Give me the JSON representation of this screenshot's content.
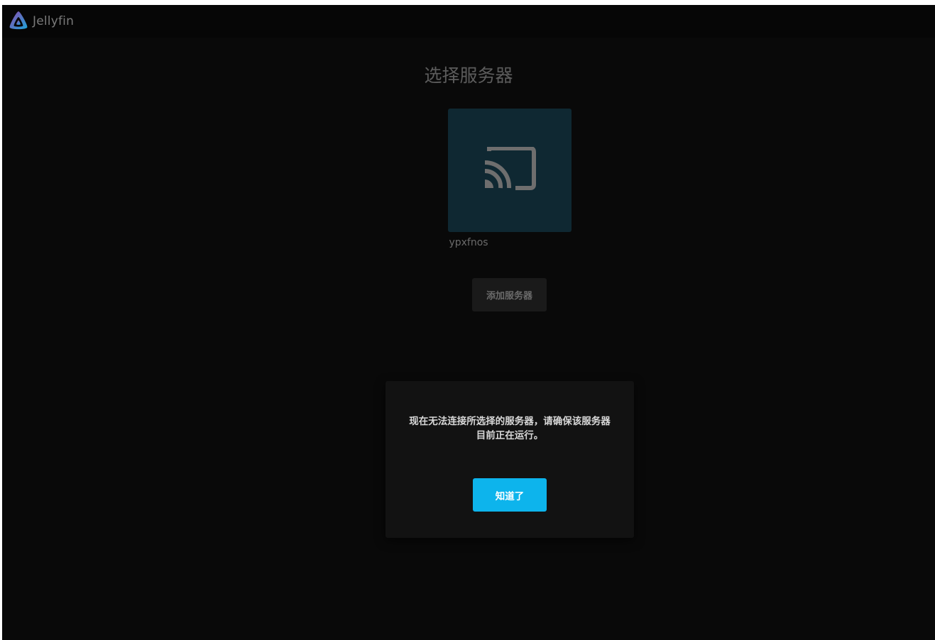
{
  "app": {
    "brand_name": "Jellyfin",
    "logo_icon": "jellyfin-logo-icon"
  },
  "page": {
    "title": "选择服务器"
  },
  "server": {
    "name": "ypxfnos",
    "icon": "cast-icon"
  },
  "actions": {
    "add_server_label": "添加服务器"
  },
  "dialog": {
    "message": "现在无法连接所选择的服务器，请确保该服务器目前正在运行。",
    "ok_label": "知道了"
  },
  "colors": {
    "accent": "#0db4ec",
    "background": "#090909",
    "card": "#0f2832",
    "dialog": "#121212"
  }
}
